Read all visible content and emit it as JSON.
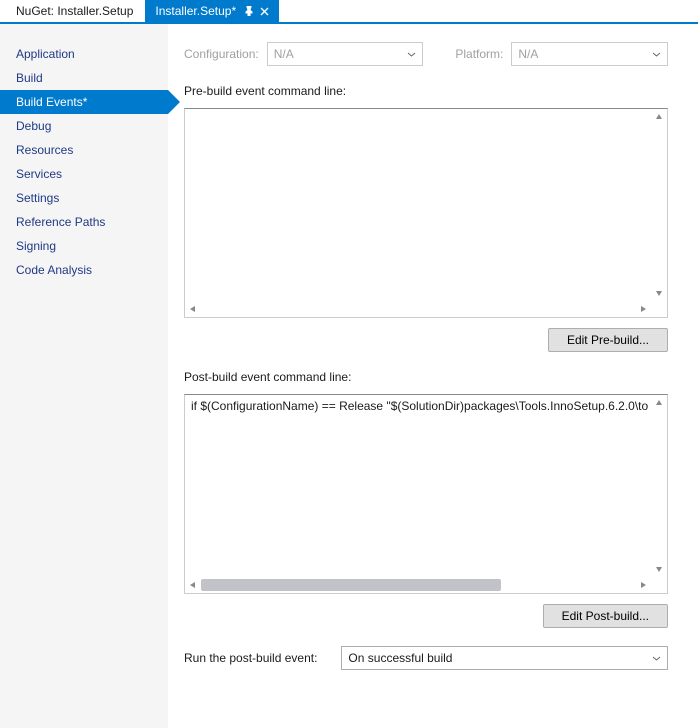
{
  "tabs": {
    "inactive": {
      "title": "NuGet: Installer.Setup"
    },
    "active": {
      "title": "Installer.Setup*"
    }
  },
  "nav": {
    "items": [
      {
        "label": "Application"
      },
      {
        "label": "Build"
      },
      {
        "label": "Build Events*"
      },
      {
        "label": "Debug"
      },
      {
        "label": "Resources"
      },
      {
        "label": "Services"
      },
      {
        "label": "Settings"
      },
      {
        "label": "Reference Paths"
      },
      {
        "label": "Signing"
      },
      {
        "label": "Code Analysis"
      }
    ],
    "selectedIndex": 2
  },
  "top": {
    "configurationLabel": "Configuration:",
    "configurationValue": "N/A",
    "platformLabel": "Platform:",
    "platformValue": "N/A"
  },
  "sections": {
    "preLabel": "Pre-build event command line:",
    "preValue": "",
    "editPre": "Edit Pre-build...",
    "postLabel": "Post-build event command line:",
    "postValue": "if $(ConfigurationName) == Release \"$(SolutionDir)packages\\Tools.InnoSetup.6.2.0\\to",
    "editPost": "Edit Post-build...",
    "runLabel": "Run the post-build event:",
    "runValue": "On successful build"
  }
}
